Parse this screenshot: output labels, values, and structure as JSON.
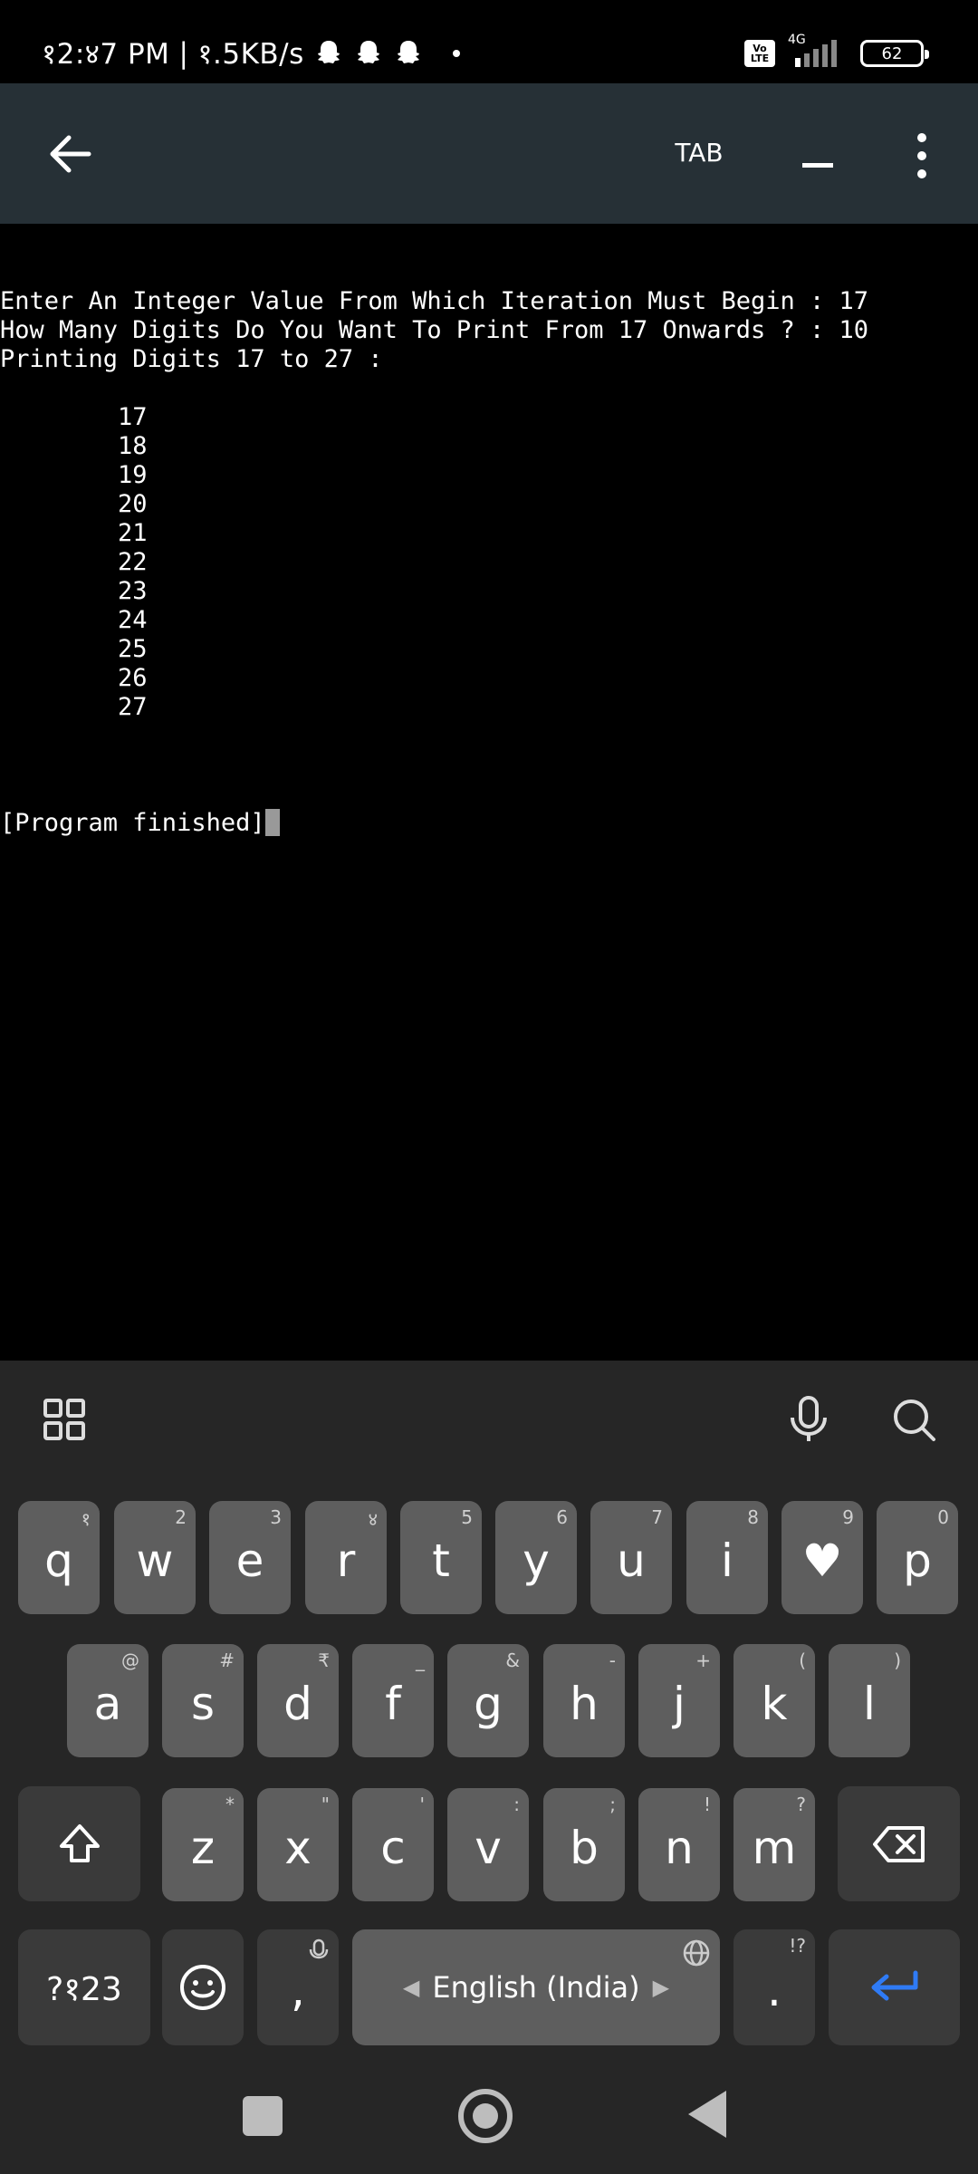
{
  "status_bar": {
    "time": "१2:४7 PM",
    "separator": "|",
    "net_speed": "१.5KB/s",
    "volte": [
      "Vo",
      "LTE"
    ],
    "network": "4G",
    "battery": "62"
  },
  "toolbar": {
    "tab_label": "TAB"
  },
  "terminal": {
    "lines": [
      "Enter An Integer Value From Which Iteration Must Begin : 17",
      "How Many Digits Do You Want To Print From 17 Onwards ? : 10",
      "Printing Digits 17 to 27 :",
      "",
      "        17",
      "        18",
      "        19",
      "        20",
      "        21",
      "        22",
      "        23",
      "        24",
      "        25",
      "        26",
      "        27",
      "",
      "",
      "",
      "[Program finished]"
    ]
  },
  "keyboard": {
    "row1": [
      {
        "key": "q",
        "hint": "१"
      },
      {
        "key": "w",
        "hint": "2"
      },
      {
        "key": "e",
        "hint": "3"
      },
      {
        "key": "r",
        "hint": "४"
      },
      {
        "key": "t",
        "hint": "5"
      },
      {
        "key": "y",
        "hint": "6"
      },
      {
        "key": "u",
        "hint": "7"
      },
      {
        "key": "i",
        "hint": "8"
      },
      {
        "key": "♥",
        "hint": "9"
      },
      {
        "key": "p",
        "hint": "0"
      }
    ],
    "row2": [
      {
        "key": "a",
        "hint": "@"
      },
      {
        "key": "s",
        "hint": "#"
      },
      {
        "key": "d",
        "hint": "₹"
      },
      {
        "key": "f",
        "hint": "_"
      },
      {
        "key": "g",
        "hint": "&"
      },
      {
        "key": "h",
        "hint": "-"
      },
      {
        "key": "j",
        "hint": "+"
      },
      {
        "key": "k",
        "hint": "("
      },
      {
        "key": "l",
        "hint": ")"
      }
    ],
    "row3": [
      {
        "key": "z",
        "hint": "*"
      },
      {
        "key": "x",
        "hint": "\""
      },
      {
        "key": "c",
        "hint": "'"
      },
      {
        "key": "v",
        "hint": ":"
      },
      {
        "key": "b",
        "hint": ";"
      },
      {
        "key": "n",
        "hint": "!"
      },
      {
        "key": "m",
        "hint": "?"
      }
    ],
    "symbols_label": "?१23",
    "comma_label": ",",
    "space_label": "English (India)",
    "period_label": ".",
    "period_hint": "!?",
    "enter_color": "#2f7bf5"
  }
}
